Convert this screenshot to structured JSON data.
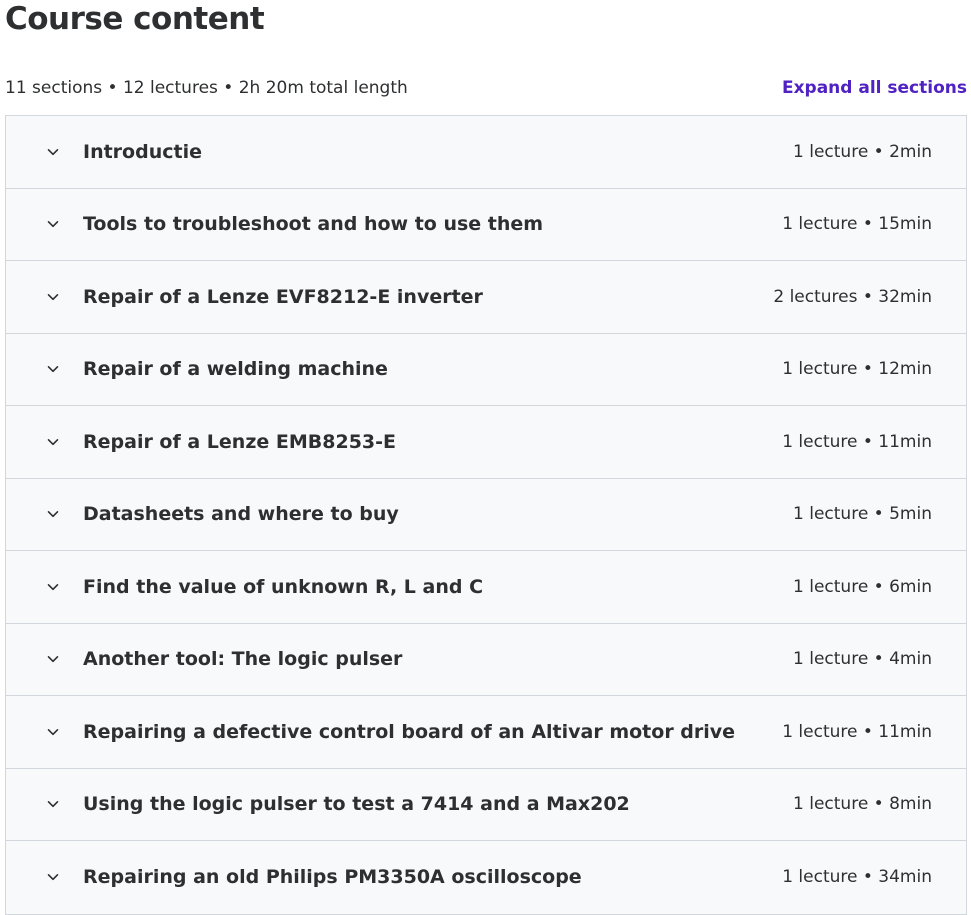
{
  "header": {
    "title": "Course content",
    "summary": "11 sections • 12 lectures • 2h 20m total length",
    "expand_label": "Expand all sections"
  },
  "colors": {
    "link": "#5022c3",
    "text": "#2d2f31",
    "row_bg": "#f7f9fa",
    "border": "#d1d7dc"
  },
  "sections": [
    {
      "title": "Introductie",
      "meta": "1 lecture • 2min",
      "icon": "chevron-down-icon"
    },
    {
      "title": "Tools to troubleshoot and how to use them",
      "meta": "1 lecture • 15min",
      "icon": "chevron-down-icon"
    },
    {
      "title": "Repair of a Lenze EVF8212-E inverter",
      "meta": "2 lectures • 32min",
      "icon": "chevron-down-icon"
    },
    {
      "title": "Repair of a welding machine",
      "meta": "1 lecture • 12min",
      "icon": "chevron-down-icon"
    },
    {
      "title": "Repair of a Lenze EMB8253-E",
      "meta": "1 lecture • 11min",
      "icon": "chevron-down-icon"
    },
    {
      "title": "Datasheets and where to buy",
      "meta": "1 lecture • 5min",
      "icon": "chevron-down-icon"
    },
    {
      "title": "Find the value of unknown R, L and C",
      "meta": "1 lecture • 6min",
      "icon": "chevron-down-icon"
    },
    {
      "title": "Another tool: The logic pulser",
      "meta": "1 lecture • 4min",
      "icon": "chevron-down-icon"
    },
    {
      "title": "Repairing a defective control board of an Altivar motor drive",
      "meta": "1 lecture • 11min",
      "icon": "chevron-down-icon"
    },
    {
      "title": "Using the logic pulser to test a 7414 and a Max202",
      "meta": "1 lecture • 8min",
      "icon": "chevron-down-icon"
    },
    {
      "title": "Repairing an old Philips PM3350A oscilloscope",
      "meta": "1 lecture • 34min",
      "icon": "chevron-down-icon"
    }
  ]
}
